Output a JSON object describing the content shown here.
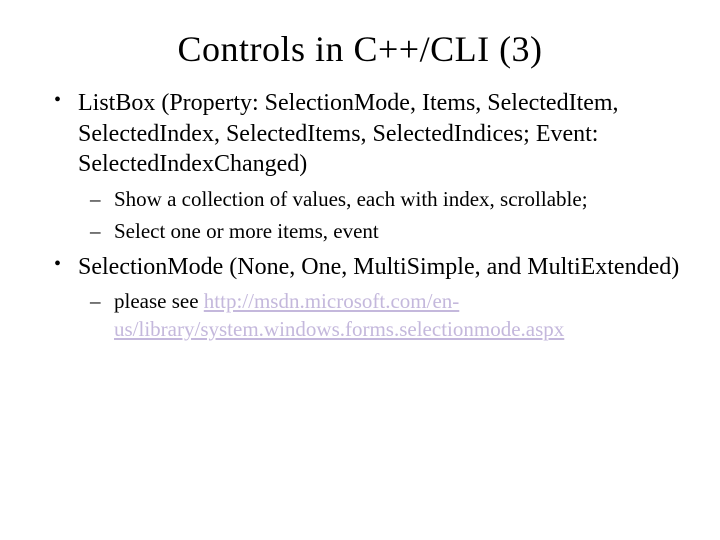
{
  "title": "Controls in C++/CLI (3)",
  "bullets": [
    {
      "text": "ListBox (Property: SelectionMode, Items, SelectedItem, SelectedIndex, SelectedItems, SelectedIndices; Event: SelectedIndexChanged)",
      "sub": [
        "Show a collection of values, each with index, scrollable;",
        "Select one or more items, event"
      ]
    },
    {
      "text": "SelectionMode (None, One, MultiSimple, and MultiExtended)",
      "sub_prefix": "please see ",
      "sub_link": "http://msdn.microsoft.com/en-us/library/system.windows.forms.selectionmode.aspx"
    }
  ]
}
